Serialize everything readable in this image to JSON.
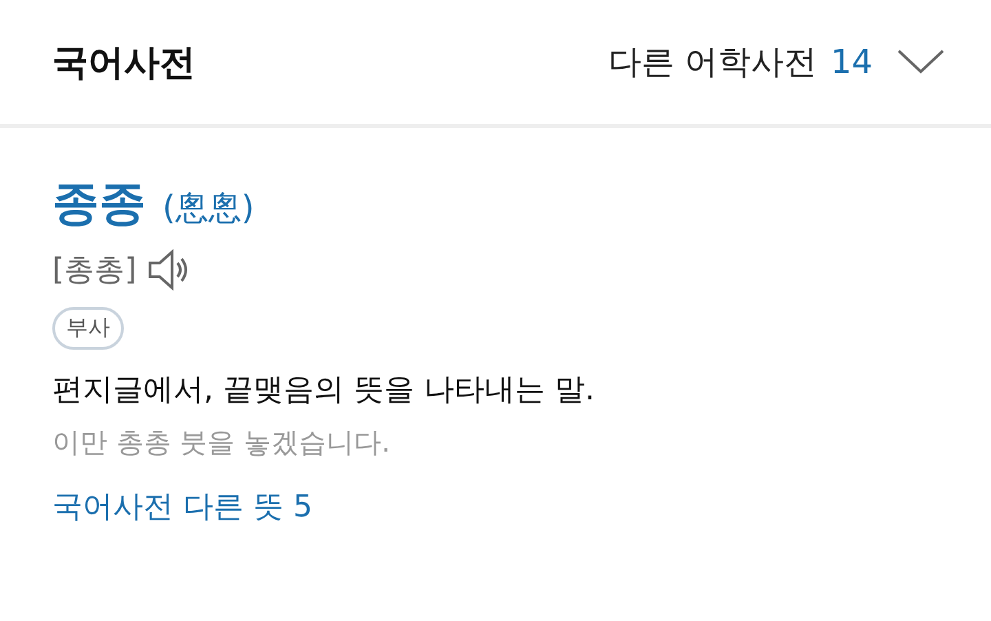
{
  "header": {
    "title": "국어사전",
    "other_dictionaries": {
      "label": "다른 어학사전",
      "count": "14"
    }
  },
  "entry": {
    "headword": "종종",
    "hanja": "(悤悤)",
    "pronunciation": "[총총]",
    "part_of_speech": "부사",
    "definition": "편지글에서, 끝맺음의 뜻을 나타내는 말.",
    "example": "이만 총총 붓을 놓겠습니다.",
    "more_link": "국어사전 다른 뜻 5"
  }
}
